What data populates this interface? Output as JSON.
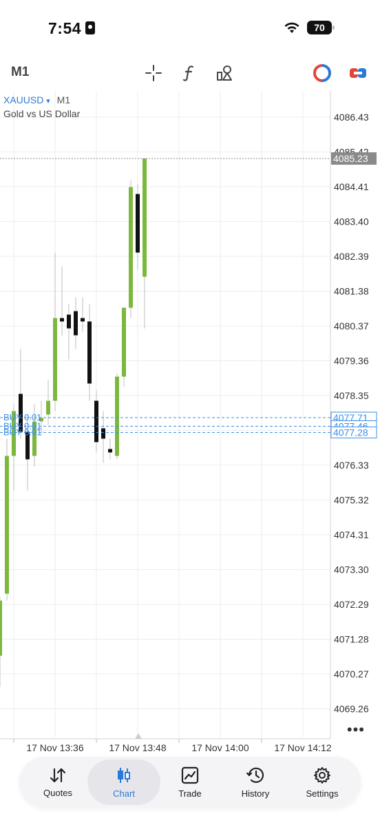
{
  "status_bar": {
    "time": "7:54",
    "battery": "70"
  },
  "toolbar": {
    "timeframe": "M1"
  },
  "symbol": {
    "name": "XAUUSD",
    "arrow": "▾",
    "timeframe": "M1",
    "description": "Gold vs US Dollar"
  },
  "chart_data": {
    "type": "candlestick",
    "y_ticks": [
      4086.43,
      4085.42,
      4084.41,
      4083.4,
      4082.39,
      4081.38,
      4080.37,
      4079.36,
      4078.35,
      4077.34,
      4076.33,
      4075.32,
      4074.31,
      4073.3,
      4072.29,
      4071.28,
      4070.27,
      4069.26
    ],
    "y_tick_labels": [
      "4086.43",
      "4085.42",
      "4084.41",
      "4083.40",
      "4082.39",
      "4081.38",
      "4080.37",
      "4079.36",
      "4078.35",
      "4077.34",
      "4076.33",
      "4075.32",
      "4074.31",
      "4073.30",
      "4072.29",
      "4071.28",
      "4070.27",
      "4069.26"
    ],
    "x_tick_labels": [
      "17 Nov 13:36",
      "17 Nov 13:48",
      "17 Nov 14:00",
      "17 Nov 14:12"
    ],
    "current_price": 4085.23,
    "current_price_label": "4085.23",
    "order_lines": [
      {
        "label": "BUY 0.01",
        "price": 4077.71,
        "price_label": "4077.71"
      },
      {
        "label": "BUY 0.01",
        "price": 4077.46,
        "price_label": "4077.46"
      },
      {
        "label": "BUY 0.01",
        "price": 4077.28,
        "price_label": "4077.28"
      }
    ],
    "candles": [
      {
        "o": 4070.8,
        "h": 4072.5,
        "l": 4069.9,
        "c": 4072.4
      },
      {
        "o": 4072.6,
        "h": 4077.1,
        "l": 4072.4,
        "c": 4076.6
      },
      {
        "o": 4076.6,
        "h": 4078.1,
        "l": 4075.6,
        "c": 4077.9
      },
      {
        "o": 4078.4,
        "h": 4079.7,
        "l": 4077.1,
        "c": 4077.3
      },
      {
        "o": 4077.3,
        "h": 4077.8,
        "l": 4075.6,
        "c": 4076.5
      },
      {
        "o": 4076.6,
        "h": 4078.1,
        "l": 4076.3,
        "c": 4077.6
      },
      {
        "o": 4077.6,
        "h": 4078.2,
        "l": 4077.2,
        "c": 4077.7
      },
      {
        "o": 4077.8,
        "h": 4078.8,
        "l": 4077.5,
        "c": 4078.2
      },
      {
        "o": 4078.2,
        "h": 4082.5,
        "l": 4077.9,
        "c": 4080.6
      },
      {
        "o": 4080.6,
        "h": 4082.1,
        "l": 4080.1,
        "c": 4080.5
      },
      {
        "o": 4080.7,
        "h": 4081.0,
        "l": 4079.4,
        "c": 4080.3
      },
      {
        "o": 4080.8,
        "h": 4081.2,
        "l": 4079.7,
        "c": 4080.1
      },
      {
        "o": 4080.6,
        "h": 4081.2,
        "l": 4080.2,
        "c": 4080.5
      },
      {
        "o": 4080.5,
        "h": 4081.0,
        "l": 4078.2,
        "c": 4078.7
      },
      {
        "o": 4078.2,
        "h": 4078.5,
        "l": 4076.7,
        "c": 4077.0
      },
      {
        "o": 4077.4,
        "h": 4077.9,
        "l": 4076.4,
        "c": 4077.1
      },
      {
        "o": 4076.8,
        "h": 4077.1,
        "l": 4076.5,
        "c": 4076.7
      },
      {
        "o": 4076.6,
        "h": 4079.0,
        "l": 4076.5,
        "c": 4078.9
      },
      {
        "o": 4078.9,
        "h": 4080.7,
        "l": 4078.6,
        "c": 4080.9
      },
      {
        "o": 4080.9,
        "h": 4084.6,
        "l": 4080.6,
        "c": 4084.4
      },
      {
        "o": 4084.2,
        "h": 4084.5,
        "l": 4082.0,
        "c": 4082.5
      },
      {
        "o": 4081.8,
        "h": 4085.23,
        "l": 4080.3,
        "c": 4085.23
      }
    ]
  },
  "tabs": [
    {
      "id": "quotes",
      "label": "Quotes",
      "icon": "sort-arrows-icon"
    },
    {
      "id": "chart",
      "label": "Chart",
      "icon": "candlestick-icon",
      "active": true
    },
    {
      "id": "trade",
      "label": "Trade",
      "icon": "trend-chart-icon"
    },
    {
      "id": "history",
      "label": "History",
      "icon": "history-icon"
    },
    {
      "id": "settings",
      "label": "Settings",
      "icon": "gear-icon"
    }
  ],
  "colors": {
    "bull": "#7cb83d",
    "bear": "#111111",
    "accent": "#2979d8",
    "order_line": "#3a8ee6",
    "grid": "#ececec"
  }
}
